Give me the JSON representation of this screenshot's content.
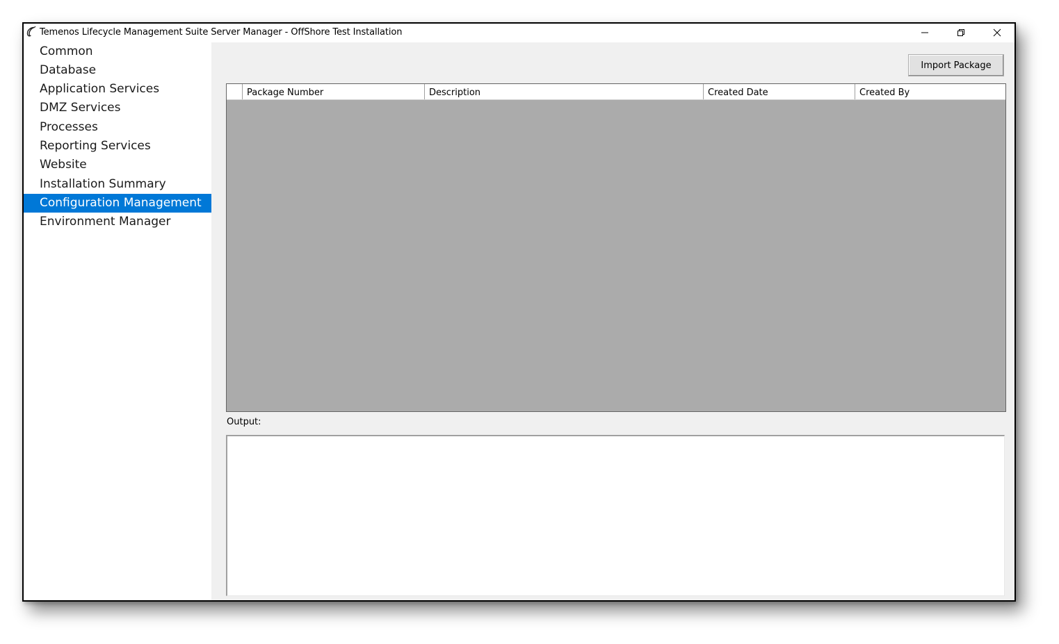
{
  "window": {
    "title": "Temenos Lifecycle Management Suite Server Manager - OffShore Test Installation"
  },
  "sidebar": {
    "items": [
      {
        "label": "Common",
        "selected": false
      },
      {
        "label": "Database",
        "selected": false
      },
      {
        "label": "Application Services",
        "selected": false
      },
      {
        "label": "DMZ Services",
        "selected": false
      },
      {
        "label": "Processes",
        "selected": false
      },
      {
        "label": "Reporting Services",
        "selected": false
      },
      {
        "label": "Website",
        "selected": false
      },
      {
        "label": "Installation Summary",
        "selected": false
      },
      {
        "label": "Configuration Management",
        "selected": true
      },
      {
        "label": "Environment Manager",
        "selected": false
      }
    ]
  },
  "main": {
    "import_button": "Import Package",
    "grid": {
      "columns": [
        "Package Number",
        "Description",
        "Created Date",
        "Created By"
      ],
      "rows": []
    },
    "output_label": "Output:",
    "output_value": ""
  },
  "colors": {
    "selection": "#0078d7",
    "grid_background": "#ababab",
    "panel_background": "#f0f0f0"
  }
}
